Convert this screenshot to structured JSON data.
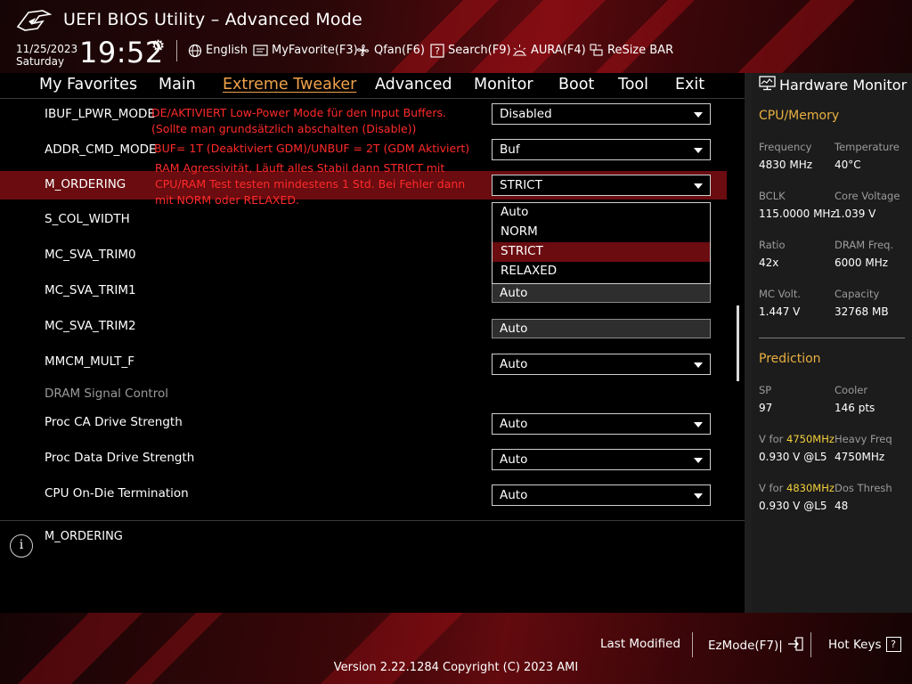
{
  "header": {
    "title": "UEFI BIOS Utility – Advanced Mode",
    "date": "11/25/2023",
    "weekday": "Saturday",
    "time": "19:52",
    "tools": [
      {
        "label": "English",
        "icon": "globe-icon"
      },
      {
        "label": "MyFavorite(F3)",
        "icon": "favorite-icon"
      },
      {
        "label": "Qfan(F6)",
        "icon": "fan-icon"
      },
      {
        "label": "Search(F9)",
        "icon": "search-icon"
      },
      {
        "label": "AURA(F4)",
        "icon": "aura-icon"
      },
      {
        "label": "ReSize BAR",
        "icon": "resize-bar-icon"
      }
    ]
  },
  "menu": {
    "items": [
      "My Favorites",
      "Main",
      "Extreme Tweaker",
      "Advanced",
      "Monitor",
      "Boot",
      "Tool",
      "Exit"
    ],
    "active": "Extreme Tweaker"
  },
  "settings": {
    "rows": [
      {
        "label": "IBUF_LPWR_MODE",
        "value": "Disabled"
      },
      {
        "label": "ADDR_CMD_MODE",
        "value": "Buf"
      },
      {
        "label": "M_ORDERING",
        "value": "STRICT"
      },
      {
        "label": "S_COL_WIDTH",
        "value": ""
      },
      {
        "label": "MC_SVA_TRIM0",
        "value": ""
      },
      {
        "label": "MC_SVA_TRIM1",
        "value": "Auto"
      },
      {
        "label": "MC_SVA_TRIM2",
        "value": "Auto"
      },
      {
        "label": "MMCM_MULT_F",
        "value": "Auto"
      },
      {
        "label": "Proc CA Drive Strength",
        "value": "Auto"
      },
      {
        "label": "Proc Data Drive Strength",
        "value": "Auto"
      },
      {
        "label": "CPU On-Die Termination",
        "value": "Auto"
      }
    ],
    "section_header": "DRAM Signal Control",
    "notes": {
      "ibuf_1": "DE/AKTIVIERT Low-Power Mode für den Input Buffers.",
      "ibuf_2": "(Sollte man grundsätzlich abschalten (Disable))",
      "addr": "BUF= 1T (Deaktiviert GDM)/UNBUF = 2T (GDM Aktiviert)",
      "mord_1": "RAM Agressivität, Läuft alles Stabil dann STRICT mit",
      "mord_2": "CPU/RAM Test testen mindestens 1 Std. Bei Fehler dann",
      "mord_3": "mit NORM oder RELAXED."
    },
    "dropdown": {
      "options": [
        "Auto",
        "NORM",
        "STRICT",
        "RELAXED"
      ],
      "selected": "STRICT"
    }
  },
  "help": {
    "text": "M_ORDERING"
  },
  "hw_monitor": {
    "title": "Hardware Monitor",
    "cpu_memory": {
      "section": "CPU/Memory",
      "frequency_label": "Frequency",
      "frequency": "4830 MHz",
      "temperature_label": "Temperature",
      "temperature": "40°C",
      "bclk_label": "BCLK",
      "bclk": "115.0000 MHz",
      "core_voltage_label": "Core Voltage",
      "core_voltage": "1.039 V",
      "ratio_label": "Ratio",
      "ratio": "42x",
      "dram_freq_label": "DRAM Freq.",
      "dram_freq": "6000 MHz",
      "mc_volt_label": "MC Volt.",
      "mc_volt": "1.447 V",
      "capacity_label": "Capacity",
      "capacity": "32768 MB"
    },
    "prediction": {
      "section": "Prediction",
      "sp_label": "SP",
      "sp": "97",
      "cooler_label": "Cooler",
      "cooler": "146 pts",
      "v_for_label": "V for",
      "v1_freq": "4750MHz",
      "v1_value": "0.930 V @L5",
      "heavy_freq_label": "Heavy Freq",
      "heavy_freq": "4750MHz",
      "v2_freq": "4830MHz",
      "v2_value": "0.930 V @L5",
      "dos_thresh_label": "Dos Thresh",
      "dos_thresh": "48"
    }
  },
  "footer": {
    "last_modified": "Last Modified",
    "ezmode": "EzMode(F7)|",
    "hot_keys": "Hot Keys",
    "version": "Version 2.22.1284 Copyright (C) 2023 AMI"
  },
  "colors": {
    "accent": "#f0a24a",
    "note_red": "#ff2a2a",
    "highlight": "#6a0c10",
    "hw_section": "#e9b040"
  }
}
